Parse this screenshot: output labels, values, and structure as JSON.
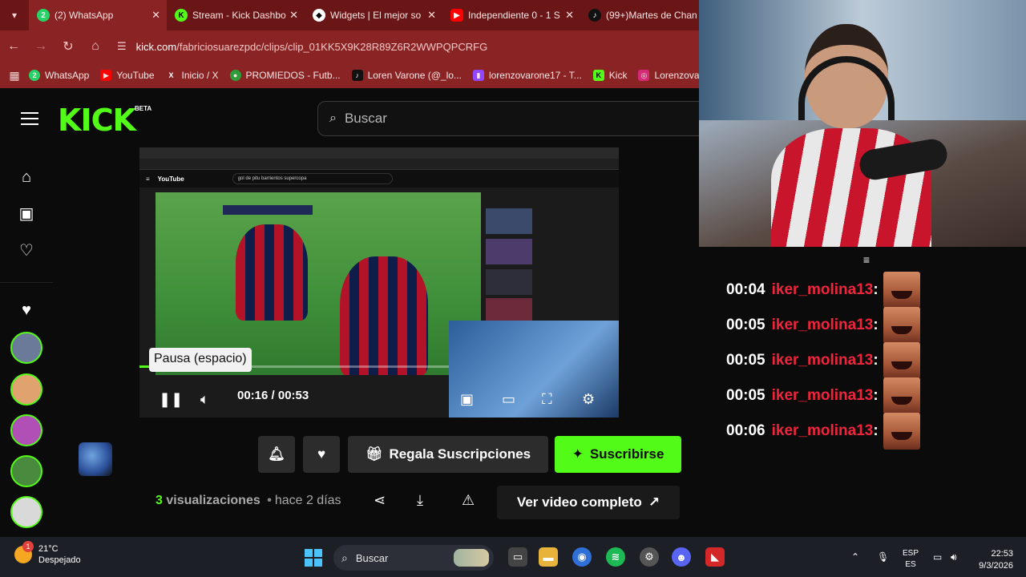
{
  "browser": {
    "tabs": [
      {
        "title": "(2) WhatsApp",
        "icon": "whatsapp-icon",
        "badge": "2",
        "color": "#25d366"
      },
      {
        "title": "Stream - Kick Dashbo",
        "icon": "kick-icon",
        "color": "#53fc18"
      },
      {
        "title": "Widgets | El mejor so",
        "icon": "widgets-icon",
        "color": "#ffffff"
      },
      {
        "title": "Independiente 0 - 1 S",
        "icon": "youtube-icon",
        "color": "#ff0000"
      },
      {
        "title": "(99+)Martes de Chan",
        "icon": "tiktok-icon",
        "color": "#111111"
      }
    ],
    "url": {
      "host": "kick.com",
      "path": "/fabriciosuarezpdc/clips/clip_01KK5X9K28R89Z6R2WWPQPCRFG"
    },
    "bookmarks": [
      {
        "label": "WhatsApp",
        "icon": "whatsapp-icon",
        "color": "#25d366"
      },
      {
        "label": "YouTube",
        "icon": "youtube-icon",
        "color": "#ff0000"
      },
      {
        "label": "Inicio / X",
        "icon": "x-icon",
        "color": "#ffffff"
      },
      {
        "label": "PROMIEDOS - Futb...",
        "icon": "promiedos-icon",
        "color": "#2e9e3b"
      },
      {
        "label": "Loren Varone (@_lo...",
        "icon": "tiktok-icon",
        "color": "#111111"
      },
      {
        "label": "lorenzovarone17 - T...",
        "icon": "twitch-icon",
        "color": "#9146ff"
      },
      {
        "label": "Kick",
        "icon": "kick-icon",
        "color": "#53fc18"
      },
      {
        "label": "Lorenzovar",
        "icon": "instagram-icon",
        "color": "#d62976"
      }
    ]
  },
  "kick": {
    "logo": "KICK",
    "beta": "BETA",
    "search_placeholder": "Buscar",
    "player": {
      "tooltip": "Pausa (espacio)",
      "time": "00:16 / 00:53",
      "progress_fraction": 0.3,
      "inner_search": "gol de pitu barrientos supercopa",
      "inner_youtube": "YouTube"
    },
    "buttons": {
      "gift": "Regala Suscripciones",
      "subscribe": "Suscribirse",
      "full_video": "Ver video completo"
    },
    "meta": {
      "views_count": "3",
      "views_label": "visualizaciones",
      "separator": "•",
      "ago": "hace 2 días"
    }
  },
  "chat": {
    "messages": [
      {
        "time": "00:04",
        "user": "iker_molina13"
      },
      {
        "time": "00:05",
        "user": "iker_molina13"
      },
      {
        "time": "00:05",
        "user": "iker_molina13"
      },
      {
        "time": "00:05",
        "user": "iker_molina13"
      },
      {
        "time": "00:06",
        "user": "iker_molina13"
      }
    ],
    "separator": ":",
    "username_color": "#f0243a"
  },
  "taskbar": {
    "temperature": "21°C",
    "weather": "Despejado",
    "weather_badge": "1",
    "search_label": "Buscar",
    "lang_top": "ESP",
    "lang_bottom": "ES",
    "time": "22:53",
    "date": "9/3/2026"
  },
  "colors": {
    "kick_green": "#53fc18",
    "browser_frame": "#8a2323"
  }
}
